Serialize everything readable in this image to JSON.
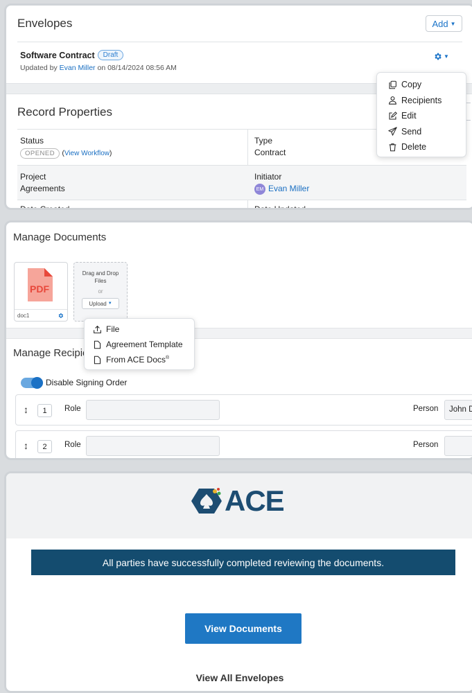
{
  "envelopes": {
    "title": "Envelopes",
    "add_label": "Add",
    "item": {
      "name": "Software Contract",
      "status": "Draft",
      "updated_prefix": "Updated by ",
      "updated_user": "Evan Miller",
      "updated_suffix": " on 08/14/2024 08:56 AM"
    },
    "gear_menu": [
      "Copy",
      "Recipients",
      "Edit",
      "Send",
      "Delete"
    ]
  },
  "record_properties": {
    "title": "Record Properties",
    "status_label": "Status",
    "status_value": "OPENED",
    "view_workflow": "View Workflow",
    "type_label": "Type",
    "type_value": "Contract",
    "project_label": "Project",
    "project_value": "Agreements",
    "initiator_label": "Initiator",
    "initiator_initials": "EM",
    "initiator_value": "Evan Miller",
    "date_created_label": "Date Created",
    "date_updated_label": "Date Updated"
  },
  "manage_documents": {
    "title": "Manage Documents",
    "doc_name": "doc1",
    "drop_text_1": "Drag and Drop",
    "drop_text_2": "Files",
    "drop_or": "or",
    "upload_label": "Upload",
    "upload_menu": [
      "File",
      "Agreement Template",
      "From ACE Docs"
    ],
    "registered_mark": "®"
  },
  "manage_recipients": {
    "title": "Manage Recipients",
    "toggle_label": "Disable Signing Order",
    "toggle_on": true,
    "rows": [
      {
        "num": "1",
        "role_label": "Role",
        "person_label": "Person",
        "person_value": "John D"
      },
      {
        "num": "2",
        "role_label": "Role",
        "person_label": "Person",
        "person_value": ""
      }
    ]
  },
  "email": {
    "logo_text": "ACE",
    "banner": "All parties have successfully completed reviewing the documents.",
    "view_documents": "View Documents",
    "view_all": "View All Envelopes",
    "colors": {
      "banner": "#144c6f",
      "button": "#1f78c4",
      "logo": "#1d4d72"
    }
  }
}
